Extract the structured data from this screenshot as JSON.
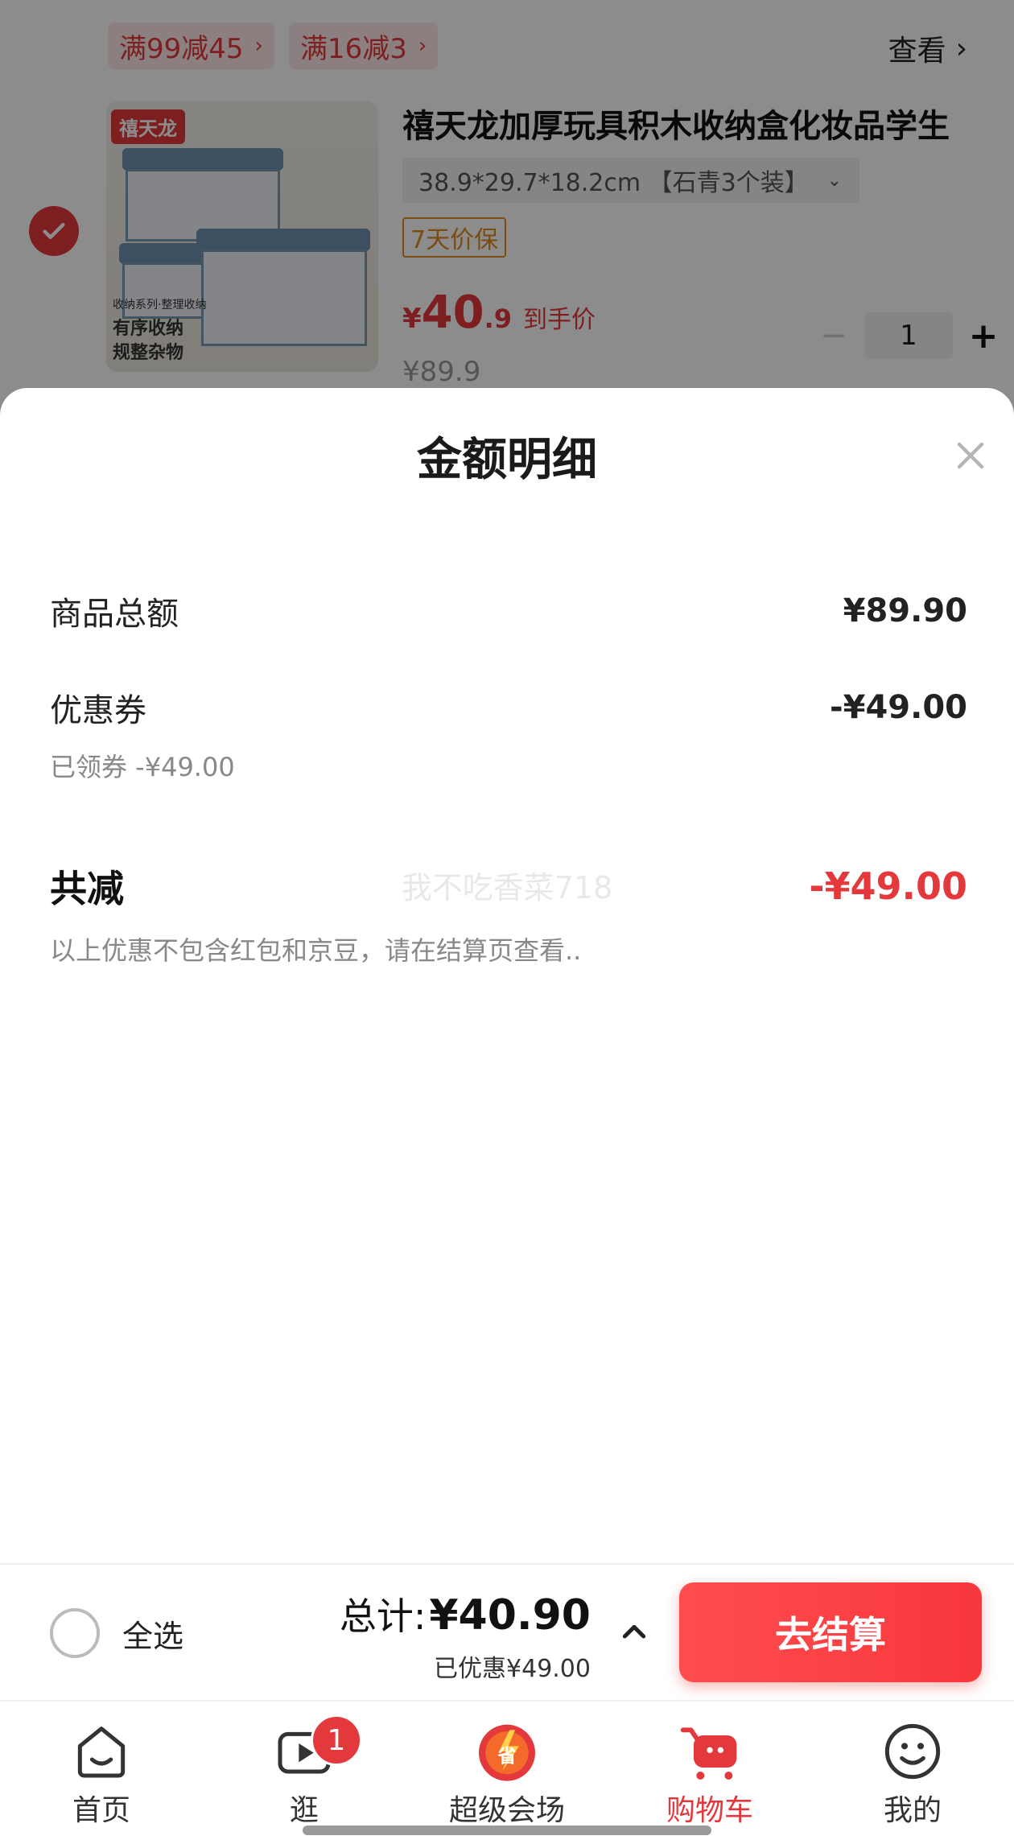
{
  "promos": [
    {
      "label": "满99减45"
    },
    {
      "label": "满16减3"
    }
  ],
  "view_link": "查看",
  "product": {
    "brand_badge": "禧天龙",
    "image_caption_small": "收纳系列·整理收纳",
    "image_caption": [
      "有序收纳",
      "规整杂物"
    ],
    "title": "禧天龙加厚玩具积木收纳盒化妆品学生",
    "spec": "38.9*29.7*18.2cm 【石青3个装】",
    "price_guard": "7天价保",
    "hand_price_yen": "¥",
    "hand_price_int": "40",
    "hand_price_dec": ".9",
    "hand_price_label": "到手价",
    "original_price": "¥89.9",
    "quantity": "1",
    "checked": true
  },
  "sheet": {
    "title": "金额明细",
    "goods_total_label": "商品总额",
    "goods_total_value": "¥89.90",
    "coupon_label": "优惠券",
    "coupon_value": "-¥49.00",
    "coupon_sub": "已领券 -¥49.00",
    "total_reduce_label": "共减",
    "total_reduce_value": "-¥49.00",
    "note": "以上优惠不包含红包和京豆，请在结算页查看..",
    "watermark": "我不吃香菜718"
  },
  "action_bar": {
    "select_all_label": "全选",
    "total_label": "总计:",
    "total_value": "¥40.90",
    "saved_text": "已优惠¥49.00",
    "checkout_label": "去结算"
  },
  "tabs": [
    {
      "label": "首页",
      "icon": "home-icon"
    },
    {
      "label": "逛",
      "icon": "video-play-icon",
      "badge": "1"
    },
    {
      "label": "超级会场",
      "icon": "super-venue-icon"
    },
    {
      "label": "购物车",
      "icon": "cart-icon",
      "active": true
    },
    {
      "label": "我的",
      "icon": "smiley-icon"
    }
  ],
  "colors": {
    "accent": "#e4393c",
    "price_guard": "#e08a1e"
  }
}
